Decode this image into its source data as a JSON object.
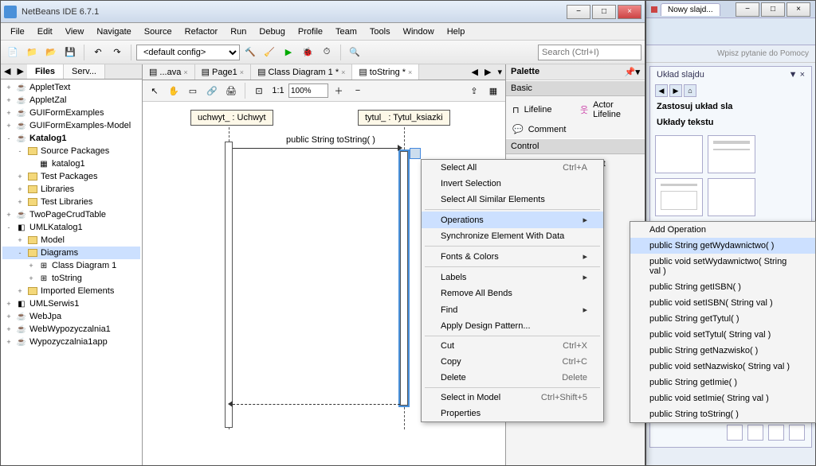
{
  "window": {
    "title": "NetBeans IDE 6.7.1"
  },
  "menubar": [
    "File",
    "Edit",
    "View",
    "Navigate",
    "Source",
    "Refactor",
    "Run",
    "Debug",
    "Profile",
    "Team",
    "Tools",
    "Window",
    "Help"
  ],
  "toolbar": {
    "config": "<default config>",
    "search_placeholder": "Search (Ctrl+I)"
  },
  "left_tabs": {
    "files": "Files",
    "services": "Serv..."
  },
  "tree": [
    {
      "ind": 0,
      "toggle": "+",
      "icon": "coffee",
      "label": "AppletText"
    },
    {
      "ind": 0,
      "toggle": "+",
      "icon": "coffee",
      "label": "AppletZal"
    },
    {
      "ind": 0,
      "toggle": "+",
      "icon": "coffee",
      "label": "GUIFormExamples"
    },
    {
      "ind": 0,
      "toggle": "+",
      "icon": "coffee",
      "label": "GUIFormExamples-Model"
    },
    {
      "ind": 0,
      "toggle": "-",
      "icon": "coffee",
      "label": "Katalog1",
      "bold": true
    },
    {
      "ind": 1,
      "toggle": "-",
      "icon": "folder",
      "label": "Source Packages"
    },
    {
      "ind": 2,
      "toggle": "",
      "icon": "pkg",
      "label": "katalog1"
    },
    {
      "ind": 1,
      "toggle": "+",
      "icon": "folder",
      "label": "Test Packages"
    },
    {
      "ind": 1,
      "toggle": "+",
      "icon": "folder",
      "label": "Libraries"
    },
    {
      "ind": 1,
      "toggle": "+",
      "icon": "folder",
      "label": "Test Libraries"
    },
    {
      "ind": 0,
      "toggle": "+",
      "icon": "coffee",
      "label": "TwoPageCrudTable"
    },
    {
      "ind": 0,
      "toggle": "-",
      "icon": "uml",
      "label": "UMLKatalog1"
    },
    {
      "ind": 1,
      "toggle": "+",
      "icon": "folder",
      "label": "Model"
    },
    {
      "ind": 1,
      "toggle": "-",
      "icon": "folder",
      "label": "Diagrams",
      "selected": true
    },
    {
      "ind": 2,
      "toggle": "+",
      "icon": "diag",
      "label": "Class Diagram 1"
    },
    {
      "ind": 2,
      "toggle": "+",
      "icon": "diag",
      "label": "toString"
    },
    {
      "ind": 1,
      "toggle": "+",
      "icon": "folder",
      "label": "Imported Elements"
    },
    {
      "ind": 0,
      "toggle": "+",
      "icon": "uml",
      "label": "UMLSerwis1"
    },
    {
      "ind": 0,
      "toggle": "+",
      "icon": "coffee",
      "label": "WebJpa"
    },
    {
      "ind": 0,
      "toggle": "+",
      "icon": "coffee",
      "label": "WebWypozyczalnia1"
    },
    {
      "ind": 0,
      "toggle": "+",
      "icon": "coffee",
      "label": "Wypozyczalnia1app"
    }
  ],
  "editor_tabs": [
    {
      "label": "...ava"
    },
    {
      "label": "Page1"
    },
    {
      "label": "Class Diagram 1 *"
    },
    {
      "label": "toString *",
      "active": true
    }
  ],
  "editor_toolbar": {
    "zoom": "100%"
  },
  "diagram": {
    "lifeline1": "uchwyt_ : Uchwyt",
    "lifeline2": "tytul_ : Tytul_ksiazki",
    "message": "public String  toString( )"
  },
  "palette": {
    "title": "Palette",
    "sections": {
      "basic": "Basic",
      "control": "Control"
    },
    "items": {
      "lifeline": "Lifeline",
      "actor": "Actor Lifeline",
      "comment": "Comment",
      "combined": "Combined Fragment"
    }
  },
  "context_menu": [
    {
      "label": "Select All",
      "shortcut": "Ctrl+A"
    },
    {
      "label": "Invert Selection"
    },
    {
      "label": "Select All Similar Elements"
    },
    {
      "sep": true
    },
    {
      "label": "Operations",
      "submenu": true,
      "highlighted": true
    },
    {
      "label": "Synchronize Element With Data"
    },
    {
      "sep": true
    },
    {
      "label": "Fonts & Colors",
      "submenu": true
    },
    {
      "sep": true
    },
    {
      "label": "Labels",
      "submenu": true
    },
    {
      "label": "Remove All Bends"
    },
    {
      "label": "Find",
      "submenu": true
    },
    {
      "label": "Apply Design Pattern..."
    },
    {
      "sep": true
    },
    {
      "label": "Cut",
      "shortcut": "Ctrl+X"
    },
    {
      "label": "Copy",
      "shortcut": "Ctrl+C"
    },
    {
      "label": "Delete",
      "shortcut": "Delete"
    },
    {
      "sep": true
    },
    {
      "label": "Select in Model",
      "shortcut": "Ctrl+Shift+5"
    },
    {
      "label": "Properties"
    }
  ],
  "submenu": [
    "Add Operation",
    "public String  getWydawnictwo( )",
    "public void  setWydawnictwo( String val )",
    "public String  getISBN( )",
    "public void  setISBN( String val )",
    "public String  getTytul( )",
    "public void  setTytul( String val )",
    "public String  getNazwisko( )",
    "public void  setNazwisko( String val )",
    "public String  getImie( )",
    "public void  setImie( String val )",
    "public String  toString( )"
  ],
  "bg": {
    "tab": "Nowy slajd...",
    "help": "Wpisz pytanie do Pomocy",
    "panel_title": "Układ slajdu",
    "apply": "Zastosuj układ sla",
    "section": "Układy tekstu"
  }
}
